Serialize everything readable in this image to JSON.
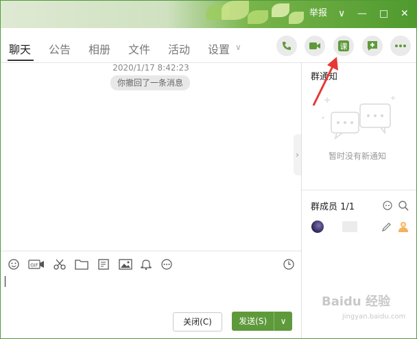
{
  "titlebar": {
    "report_label": "举报",
    "minimize": "—",
    "maximize": "□",
    "close": "✕",
    "dropdown": "∨"
  },
  "tabs": [
    {
      "label": "聊天",
      "active": true
    },
    {
      "label": "公告"
    },
    {
      "label": "相册"
    },
    {
      "label": "文件"
    },
    {
      "label": "活动"
    },
    {
      "label": "设置"
    }
  ],
  "tab_dropdown_glyph": "∨",
  "right_buttons": [
    {
      "name": "phone-icon",
      "glyph": "📞"
    },
    {
      "name": "video-icon",
      "glyph": "▶"
    },
    {
      "name": "course-icon",
      "glyph": "课"
    },
    {
      "name": "add-app-icon",
      "glyph": "+"
    },
    {
      "name": "more-icon",
      "glyph": "•••"
    }
  ],
  "chat": {
    "timestamp": "2020/1/17 8:42:23",
    "recall_message": "你撤回了一条消息"
  },
  "toolbar_icons": [
    "emoji-icon",
    "gif-icon",
    "scissors-icon",
    "folder-icon",
    "transfer-icon",
    "image-icon",
    "bell-icon",
    "more-circle-icon",
    "history-icon"
  ],
  "buttons": {
    "close_label": "关闭(C)",
    "send_label": "发送(S)",
    "send_arrow": "∨"
  },
  "notice": {
    "title": "群通知",
    "empty_text": "暂时没有新通知"
  },
  "members": {
    "title": "群成员 1/1"
  },
  "watermark": {
    "main": "Baidu 经验",
    "sub": "jingyan.baidu.com"
  },
  "colors": {
    "accent": "#5e9a3b",
    "title_green": "#4f9a2e",
    "arrow_red": "#e53935"
  }
}
